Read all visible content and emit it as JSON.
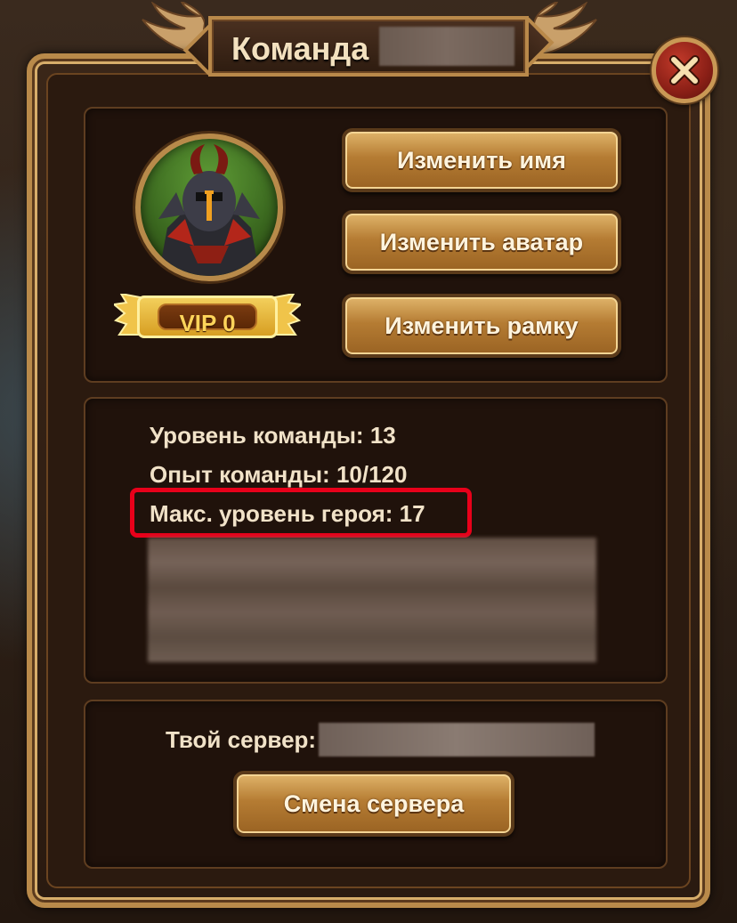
{
  "window": {
    "title": "Команда"
  },
  "profile": {
    "vip_label": "VIP 0"
  },
  "actions": {
    "change_name": "Изменить имя",
    "change_avatar": "Изменить аватар",
    "change_frame": "Изменить рамку"
  },
  "stats": {
    "team_level": "Уровень команды: 13",
    "team_exp": "Опыт команды: 10/120",
    "max_hero_level": "Макс. уровень героя: 17"
  },
  "server": {
    "label": "Твой сервер:",
    "change_button": "Смена сервера"
  },
  "icons": {
    "close": "close-icon",
    "avatar": "hero-avatar-icon"
  },
  "colors": {
    "highlight": "#e8001a",
    "button_gold": "#b57c33",
    "close_red": "#c23a2a",
    "vip_gold": "#f3cf5b"
  }
}
